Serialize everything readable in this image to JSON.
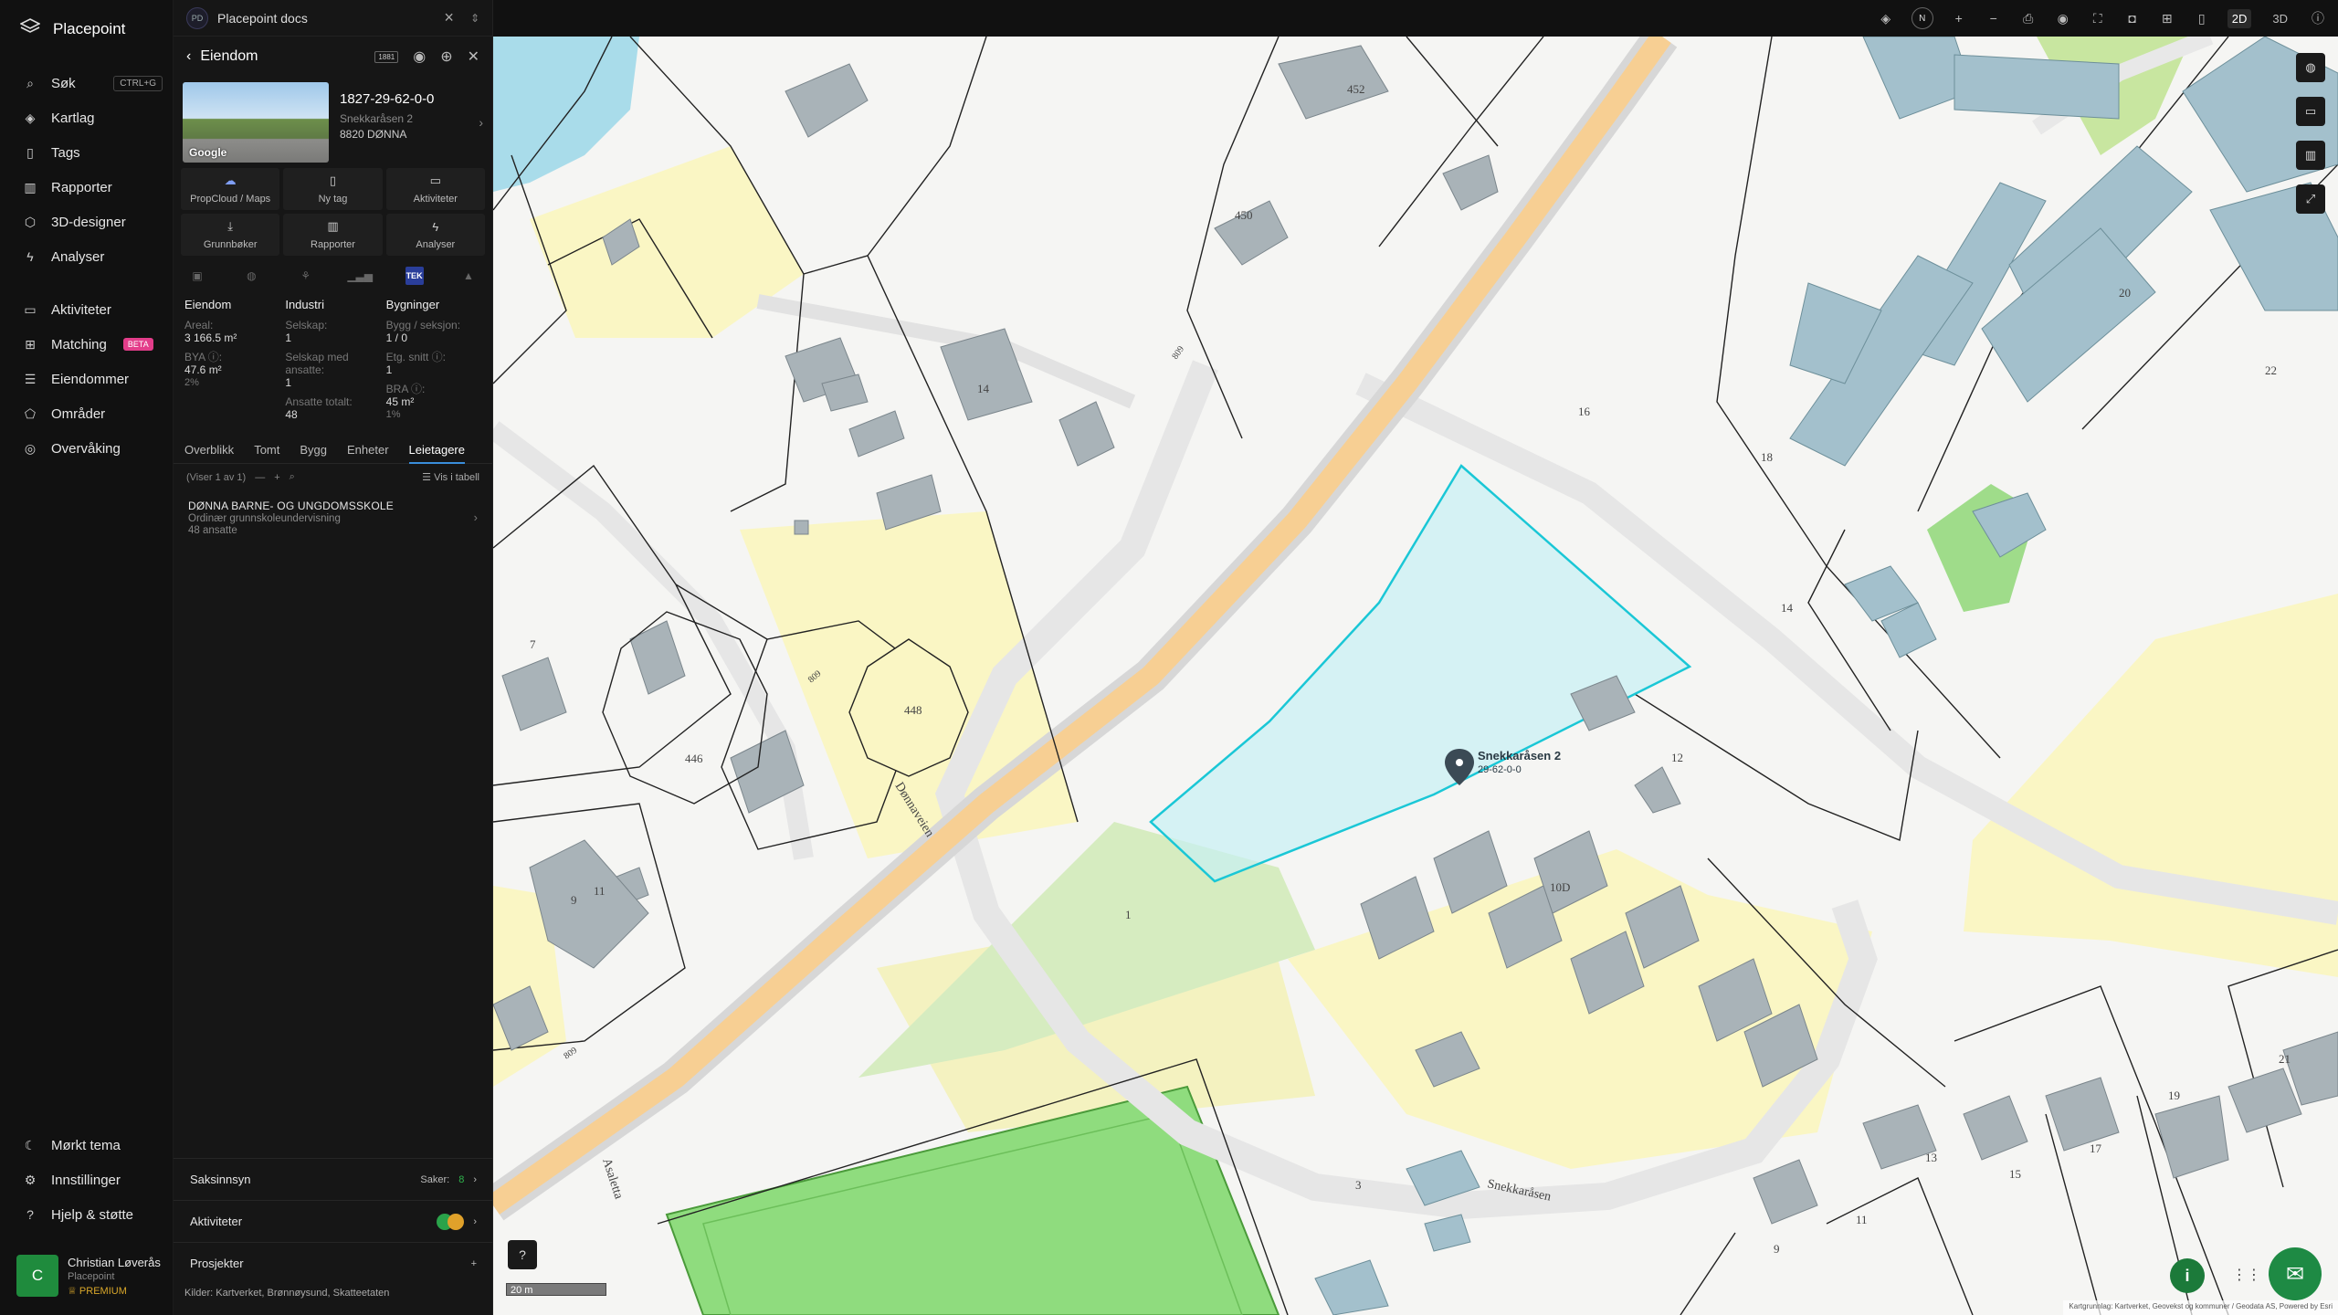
{
  "app": {
    "name": "Placepoint"
  },
  "nav": {
    "items": [
      {
        "label": "Søk",
        "icon": "search-icon",
        "shortcut": "CTRL+G"
      },
      {
        "label": "Kartlag",
        "icon": "layers-icon"
      },
      {
        "label": "Tags",
        "icon": "bookmark-icon"
      },
      {
        "label": "Rapporter",
        "icon": "chart-icon"
      },
      {
        "label": "3D-designer",
        "icon": "cube-icon"
      },
      {
        "label": "Analyser",
        "icon": "bolt-icon"
      }
    ],
    "items2": [
      {
        "label": "Aktiviteter",
        "icon": "chat-icon"
      },
      {
        "label": "Matching",
        "icon": "match-icon",
        "badge": "BETA"
      },
      {
        "label": "Eiendommer",
        "icon": "list-icon"
      },
      {
        "label": "Områder",
        "icon": "area-icon"
      },
      {
        "label": "Overvåking",
        "icon": "monitor-icon"
      }
    ],
    "bottom": [
      {
        "label": "Mørkt tema",
        "icon": "moon-icon"
      },
      {
        "label": "Innstillinger",
        "icon": "gear-icon"
      },
      {
        "label": "Hjelp & støtte",
        "icon": "help-icon"
      }
    ],
    "user": {
      "initial": "C",
      "name": "Christian Løverås",
      "org": "Placepoint",
      "plan": "PREMIUM"
    }
  },
  "docs": {
    "badge": "PD",
    "title": "Placepoint docs"
  },
  "panel": {
    "title": "Eiendom",
    "mini_badge": "1881",
    "property": {
      "id": "1827-29-62-0-0",
      "address": "Snekkaråsen 2",
      "postal": "8820 DØNNA",
      "photo_label": "Google"
    },
    "actions": [
      {
        "label": "PropCloud / Maps",
        "icon": "cloud-icon"
      },
      {
        "label": "Ny tag",
        "icon": "tag-icon"
      },
      {
        "label": "Aktiviteter",
        "icon": "chat-icon"
      },
      {
        "label": "Grunnbøker",
        "icon": "download-icon"
      },
      {
        "label": "Rapporter",
        "icon": "chart-icon"
      },
      {
        "label": "Analyser",
        "icon": "bolt-icon"
      }
    ],
    "source_tek": "TEK",
    "stats": {
      "eiendom": {
        "header": "Eiendom",
        "areal_label": "Areal:",
        "areal": "3 166.5 m²",
        "bya_label": "BYA ⓘ:",
        "bya": "47.6 m²",
        "bya_pct": "2%"
      },
      "industri": {
        "header": "Industri",
        "selskap_label": "Selskap:",
        "selskap": "1",
        "ansatte_label": "Selskap med ansatte:",
        "ansatte": "1",
        "total_label": "Ansatte totalt:",
        "total": "48"
      },
      "bygninger": {
        "header": "Bygninger",
        "bygg_label": "Bygg / seksjon:",
        "bygg": "1 / 0",
        "etg_label": "Etg. snitt ⓘ:",
        "etg": "1",
        "bra_label": "BRA ⓘ:",
        "bra": "45 m²",
        "bra_pct": "1%"
      }
    },
    "tabs": [
      "Overblikk",
      "Tomt",
      "Bygg",
      "Enheter",
      "Leietagere"
    ],
    "list": {
      "count": "(Viser 1 av 1)",
      "view": "Vis i tabell"
    },
    "tenant": {
      "name": "DØNNA BARNE- OG UNGDOMSSKOLE",
      "desc": "Ordinær grunnskoleundervisning",
      "employees": "48 ansatte"
    },
    "sections": {
      "saksinnsyn": "Saksinnsyn",
      "saker_label": "Saker:",
      "saker": "8",
      "aktiviteter": "Aktiviteter",
      "prosjekter": "Prosjekter"
    },
    "footer": {
      "label": "Kilder:",
      "sources": "Kartverket, Brønnøysund, Skatteetaten"
    }
  },
  "toolbar": {
    "compass": "N",
    "mode2d": "2D",
    "mode3d": "3D"
  },
  "map": {
    "labels": {
      "road": "Dønnaveien",
      "road2": "Snekkaråsen",
      "road3": "Asaletta",
      "route": "809",
      "selected": "Snekkaråsen 2",
      "selected_id": "29-62-0-0",
      "h452": "452",
      "h450": "450",
      "h448": "448",
      "h446": "446",
      "h14a": "14",
      "h7": "7",
      "h9": "9",
      "h11": "11",
      "h16": "16",
      "h18": "18",
      "h20": "20",
      "h22": "22",
      "h14b": "14",
      "h12": "12",
      "h10": "10D",
      "h1": "1",
      "h3": "3",
      "h13": "13",
      "h15": "15",
      "h17": "17",
      "h19": "19",
      "h21": "21",
      "h9b": "9",
      "h11b": "11"
    },
    "scale": "20 m",
    "attribution": "Kartgrunnlag: Kartverket, Geovekst og kommuner / Geodata AS, Powered by Esri"
  }
}
